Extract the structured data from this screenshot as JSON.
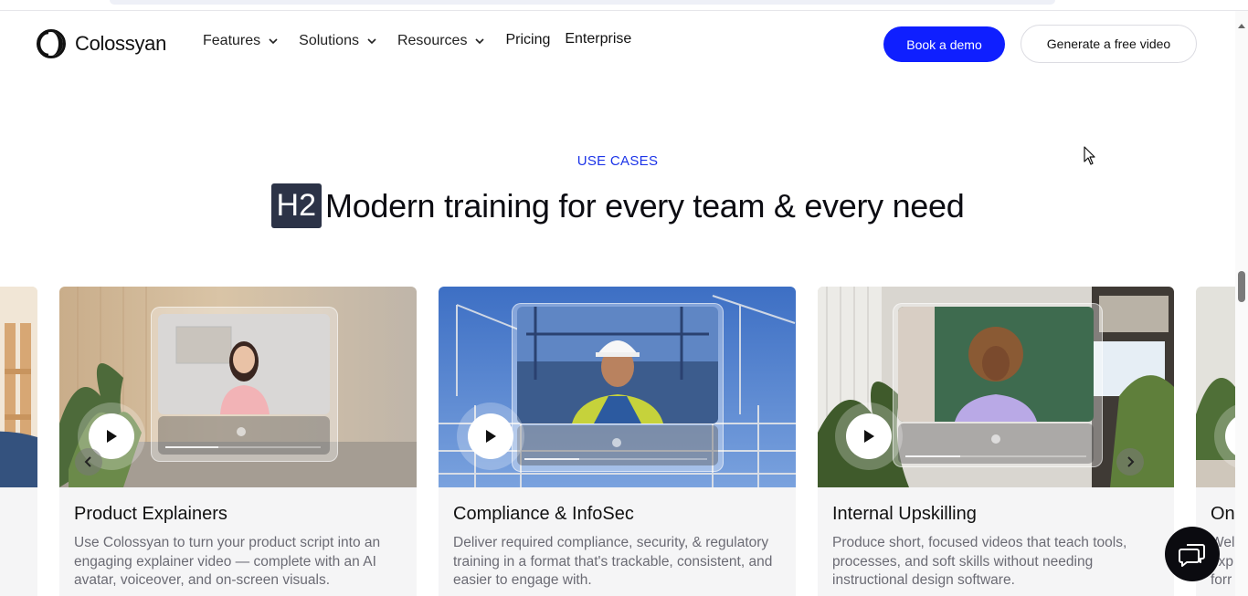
{
  "brand": {
    "name": "Colossyan",
    "accent": "#0f1fff"
  },
  "nav": {
    "items": [
      {
        "label": "Features",
        "has_dropdown": true
      },
      {
        "label": "Solutions",
        "has_dropdown": true
      },
      {
        "label": "Resources",
        "has_dropdown": true
      }
    ],
    "pricing": "Pricing",
    "enterprise": "Enterprise",
    "book_demo": "Book a demo",
    "free_video": "Generate a free video"
  },
  "section": {
    "eyebrow": "USE CASES",
    "heading_badge": "H2",
    "heading": "Modern training for every team & every need"
  },
  "cards": [
    {
      "title": "Product Explainers",
      "description": "Use Colossyan to turn your product script into an engaging explainer video — complete with an AI avatar, voiceover, and on-screen visuals."
    },
    {
      "title": "Compliance & InfoSec",
      "description": "Deliver required compliance, security, & regulatory training in a format that's trackable, consistent, and easier to engage with."
    },
    {
      "title": "Internal Upskilling",
      "description": "Produce short, focused videos that teach tools, processes, and soft skills without needing instructional design software."
    },
    {
      "title": "On",
      "description": "Wel exp forr"
    }
  ],
  "icons": {
    "play": "play-icon",
    "prev": "chevron-left-icon",
    "next": "chevron-right-icon",
    "chat": "chat-bubble-icon",
    "dropdown": "chevron-down-icon"
  }
}
